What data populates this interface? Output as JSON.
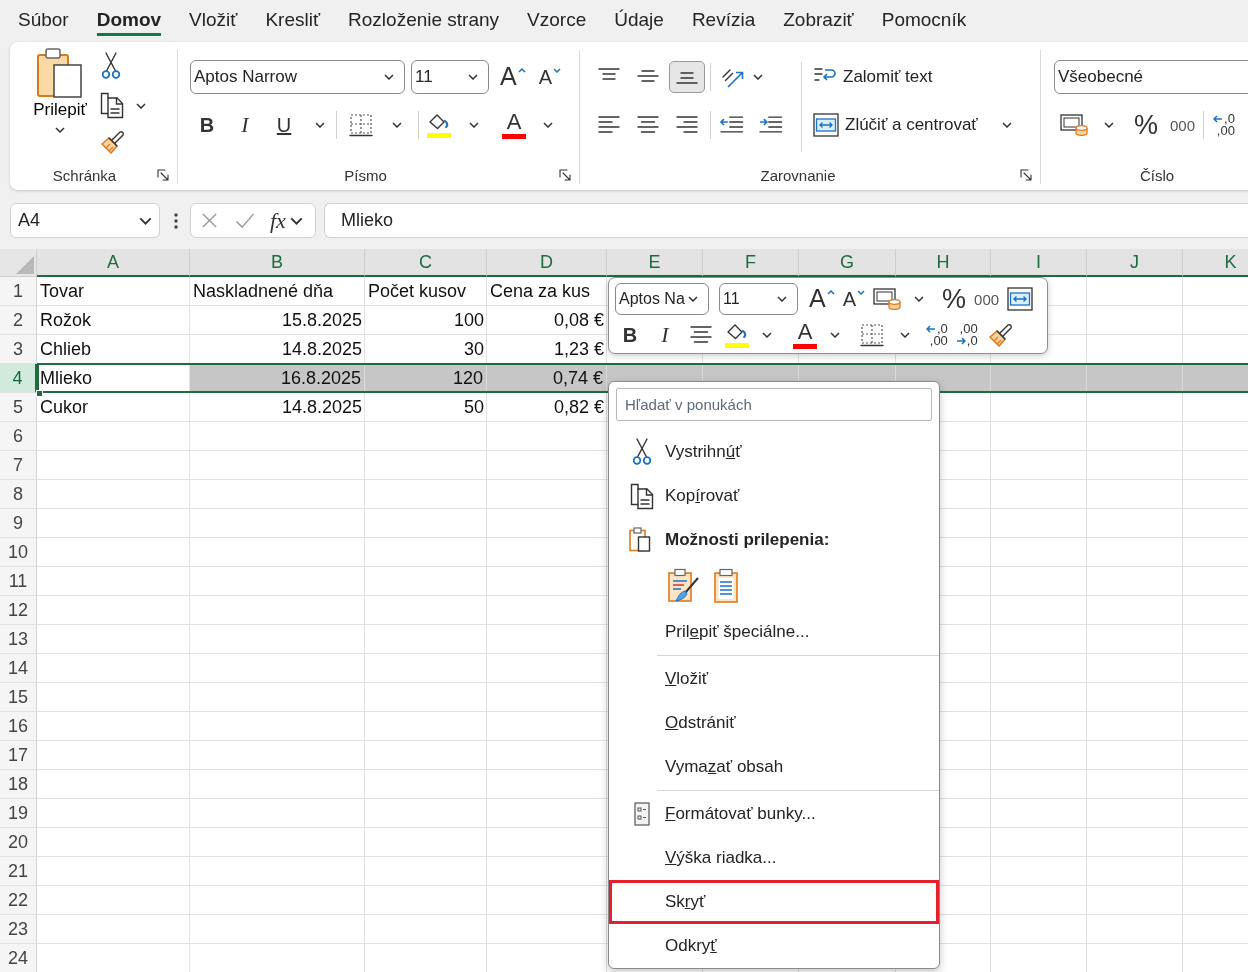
{
  "tabs": [
    {
      "label": "Súbor",
      "selected": false
    },
    {
      "label": "Domov",
      "selected": true
    },
    {
      "label": "Vložiť",
      "selected": false
    },
    {
      "label": "Kresliť",
      "selected": false
    },
    {
      "label": "Rozloženie strany",
      "selected": false
    },
    {
      "label": "Vzorce",
      "selected": false
    },
    {
      "label": "Údaje",
      "selected": false
    },
    {
      "label": "Revízia",
      "selected": false
    },
    {
      "label": "Zobraziť",
      "selected": false
    },
    {
      "label": "Pomocník",
      "selected": false
    }
  ],
  "ribbon": {
    "clipboard": {
      "paste": "Prilepiť",
      "label": "Schránka"
    },
    "font": {
      "name": "Aptos Narrow",
      "size": "11",
      "grow": "A",
      "shrink": "A",
      "bold": "B",
      "italic": "I",
      "underline": "U",
      "fill": {
        "color": "#ffff00"
      },
      "font_color": {
        "letter": "A",
        "color": "#ff0000"
      },
      "label": "Písmo"
    },
    "alignment": {
      "vertical": [
        {
          "kind": "top",
          "selected": false
        },
        {
          "kind": "middle",
          "selected": false
        },
        {
          "kind": "bottom",
          "selected": true
        }
      ],
      "horizontal": [
        {
          "kind": "left",
          "selected": false
        },
        {
          "kind": "center",
          "selected": false
        },
        {
          "kind": "right",
          "selected": false
        }
      ],
      "wrap_text": "Zalomiť text",
      "merge": "Zlúčiť a centrovať",
      "label": "Zarovnanie"
    },
    "number": {
      "format": "Všeobecné",
      "percent": "%",
      "thousands": "000",
      "increase_decimal": [
        ",0",
        ",00"
      ],
      "label": "Číslo"
    }
  },
  "formula_bar": {
    "name_box": "A4",
    "function_label": "fx",
    "formula": "Mlieko"
  },
  "sheet": {
    "columns": [
      "A",
      "B",
      "C",
      "D",
      "E",
      "F",
      "G",
      "H",
      "I",
      "J",
      "K"
    ],
    "rows": [
      {
        "number": "1",
        "selected": false,
        "cells": [
          {
            "kind": "text",
            "value": "Tovar"
          },
          {
            "kind": "text",
            "value": "Naskladnené dňa"
          },
          {
            "kind": "text",
            "value": "Počet kusov"
          },
          {
            "kind": "text",
            "value": "Cena za kus"
          }
        ]
      },
      {
        "number": "2",
        "selected": false,
        "cells": [
          {
            "kind": "text",
            "value": "Rožok"
          },
          {
            "kind": "number",
            "value": "15.8.2025"
          },
          {
            "kind": "number",
            "value": "100"
          },
          {
            "kind": "number",
            "value": "0,08 €"
          }
        ]
      },
      {
        "number": "3",
        "selected": false,
        "cells": [
          {
            "kind": "text",
            "value": "Chlieb"
          },
          {
            "kind": "number",
            "value": "14.8.2025"
          },
          {
            "kind": "number",
            "value": "30"
          },
          {
            "kind": "number",
            "value": "1,23 €"
          }
        ]
      },
      {
        "number": "4",
        "selected": true,
        "cells": [
          {
            "kind": "text",
            "value": "Mlieko"
          },
          {
            "kind": "number",
            "value": "16.8.2025"
          },
          {
            "kind": "number",
            "value": "120"
          },
          {
            "kind": "number",
            "value": "0,74 €"
          }
        ]
      },
      {
        "number": "5",
        "selected": false,
        "cells": [
          {
            "kind": "text",
            "value": "Cukor"
          },
          {
            "kind": "number",
            "value": "14.8.2025"
          },
          {
            "kind": "number",
            "value": "50"
          },
          {
            "kind": "number",
            "value": "0,82 €"
          }
        ]
      },
      {
        "number": "6",
        "selected": false
      },
      {
        "number": "7",
        "selected": false
      },
      {
        "number": "8",
        "selected": false
      },
      {
        "number": "9",
        "selected": false
      },
      {
        "number": "10",
        "selected": false
      },
      {
        "number": "11",
        "selected": false
      },
      {
        "number": "12",
        "selected": false
      },
      {
        "number": "13",
        "selected": false
      },
      {
        "number": "14",
        "selected": false
      },
      {
        "number": "15",
        "selected": false
      },
      {
        "number": "16",
        "selected": false
      },
      {
        "number": "17",
        "selected": false
      },
      {
        "number": "18",
        "selected": false
      },
      {
        "number": "19",
        "selected": false
      },
      {
        "number": "20",
        "selected": false
      },
      {
        "number": "21",
        "selected": false
      },
      {
        "number": "22",
        "selected": false
      },
      {
        "number": "23",
        "selected": false
      },
      {
        "number": "24",
        "selected": false
      }
    ]
  },
  "mini_toolbar": {
    "font": "Aptos Na",
    "size": "11",
    "grow": "A",
    "shrink": "A",
    "percent": "%",
    "thousands": "000",
    "bold": "B",
    "italic": "I",
    "fill": {
      "color": "#ffff00"
    },
    "font_color": {
      "letter": "A",
      "color": "#ff0000"
    },
    "increase_decimal": [
      ",0",
      ",00"
    ],
    "decrease_decimal": [
      ",00",
      ",0"
    ]
  },
  "context_menu": {
    "search": {
      "placeholder": "Hľadať v ponukách"
    },
    "sections": [
      {
        "items": [
          {
            "kind": "cut",
            "label": {
              "before": "Vystrihn",
              "key": "ú",
              "after": "ť"
            },
            "highlighted": false
          },
          {
            "kind": "copy",
            "label": {
              "before": "Kop",
              "key": "í",
              "after": "rovať"
            },
            "highlighted": false
          },
          {
            "kind": "paste_heading",
            "title": "Možnosti prilepenia:",
            "highlighted": false
          },
          {
            "kind": "paste_options",
            "highlighted": false
          },
          {
            "kind": "command",
            "label": {
              "before": "Pril",
              "key": "e",
              "after": "piť špeciálne..."
            },
            "highlighted": false
          }
        ]
      },
      {
        "items": [
          {
            "kind": "command",
            "label": {
              "key": "V",
              "after": "ložiť"
            },
            "highlighted": false
          },
          {
            "kind": "command",
            "label": {
              "key": "O",
              "after": "dstrániť"
            },
            "highlighted": false
          },
          {
            "kind": "command",
            "label": {
              "before": "Vyma",
              "key": "z",
              "after": "ať obsah"
            },
            "highlighted": false
          }
        ]
      },
      {
        "items": [
          {
            "kind": "format_cells",
            "label": {
              "key": "F",
              "after": "ormátovať bunky..."
            },
            "highlighted": false
          },
          {
            "kind": "command",
            "label": {
              "key": "V",
              "after": "ýška riadka..."
            },
            "highlighted": false
          },
          {
            "kind": "command",
            "label": {
              "before": "Sk",
              "key": "r",
              "after": "yť"
            },
            "highlighted": true
          },
          {
            "kind": "command",
            "label": {
              "before": "Odkry",
              "key": "ť"
            },
            "highlighted": false
          }
        ]
      }
    ]
  }
}
